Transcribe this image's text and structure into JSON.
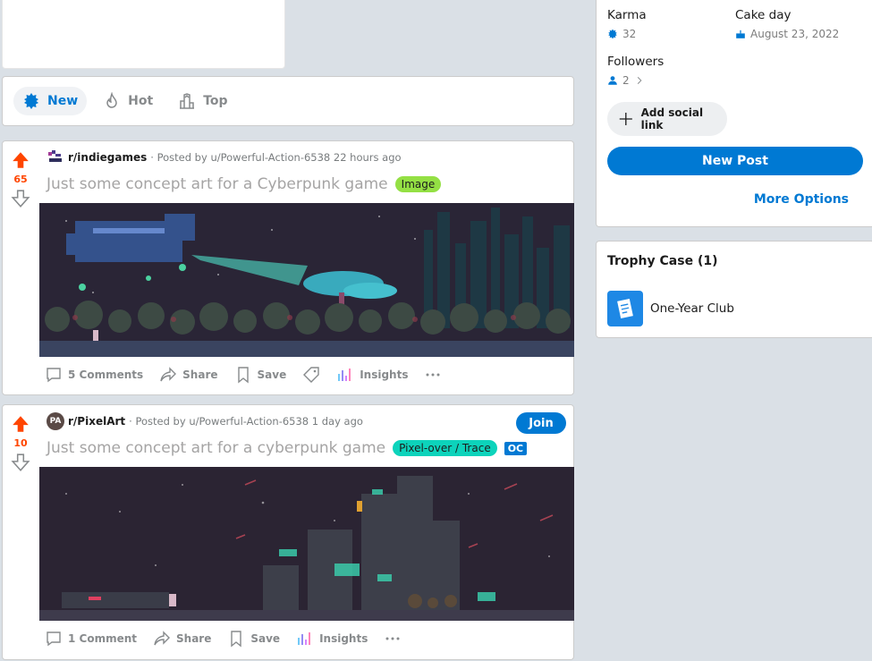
{
  "sort": {
    "new_label": "New",
    "hot_label": "Hot",
    "top_label": "Top"
  },
  "posts": [
    {
      "votes": "65",
      "subreddit": "r/indiegames",
      "posted_by": "· Posted by u/Powerful-Action-6538 22 hours ago",
      "title": "Just some concept art for a Cyberpunk game",
      "flair": "Image",
      "flair_color": "#94e044",
      "comments": "5 Comments",
      "share": "Share",
      "save": "Save",
      "insights": "Insights"
    },
    {
      "votes": "10",
      "subreddit": "r/PixelArt",
      "subreddit_icon_text": "PA",
      "posted_by": "· Posted by u/Powerful-Action-6538 1 day ago",
      "title": "Just some concept art for a cyberpunk game",
      "flair": "Pixel-over / Trace",
      "flair_color": "#0dd3bb",
      "oc_label": "OC",
      "join_label": "Join",
      "comments": "1 Comment",
      "share": "Share",
      "save": "Save",
      "insights": "Insights"
    }
  ],
  "profile": {
    "karma_label": "Karma",
    "karma_value": "32",
    "cakeday_label": "Cake day",
    "cakeday_value": "August 23, 2022",
    "followers_label": "Followers",
    "followers_value": "2",
    "social_link_label": "Add social link",
    "new_post_label": "New Post",
    "more_options_label": "More Options"
  },
  "trophy": {
    "title": "Trophy Case (1)",
    "item": "One-Year Club"
  },
  "colors": {
    "accent": "#0079d3",
    "upvote": "#ff4500"
  }
}
